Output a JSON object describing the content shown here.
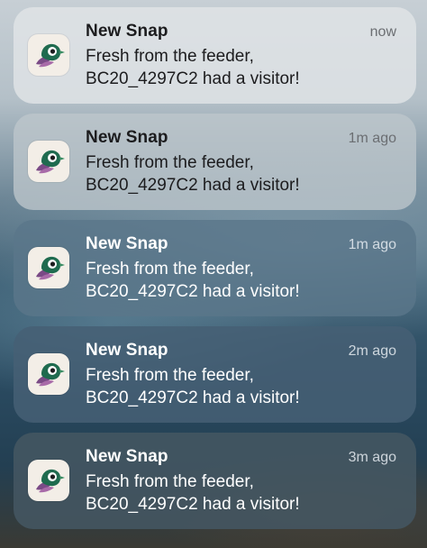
{
  "notifications": [
    {
      "title": "New Snap",
      "time": "now",
      "line1": "Fresh from the feeder,",
      "line2": "BC20_4297C2 had a visitor!",
      "icon": "bird-feeder-app-icon"
    },
    {
      "title": "New Snap",
      "time": "1m ago",
      "line1": "Fresh from the feeder,",
      "line2": "BC20_4297C2 had a visitor!",
      "icon": "bird-feeder-app-icon"
    },
    {
      "title": "New Snap",
      "time": "1m ago",
      "line1": "Fresh from the feeder,",
      "line2": "BC20_4297C2 had a visitor!",
      "icon": "bird-feeder-app-icon"
    },
    {
      "title": "New Snap",
      "time": "2m ago",
      "line1": "Fresh from the feeder,",
      "line2": "BC20_4297C2 had a visitor!",
      "icon": "bird-feeder-app-icon"
    },
    {
      "title": "New Snap",
      "time": "3m ago",
      "line1": "Fresh from the feeder,",
      "line2": "BC20_4297C2 had a visitor!",
      "icon": "bird-feeder-app-icon"
    }
  ],
  "colors": {
    "icon_green": "#1f6b4f",
    "icon_purple": "#7a4a86",
    "icon_bg": "#f3eee7"
  }
}
